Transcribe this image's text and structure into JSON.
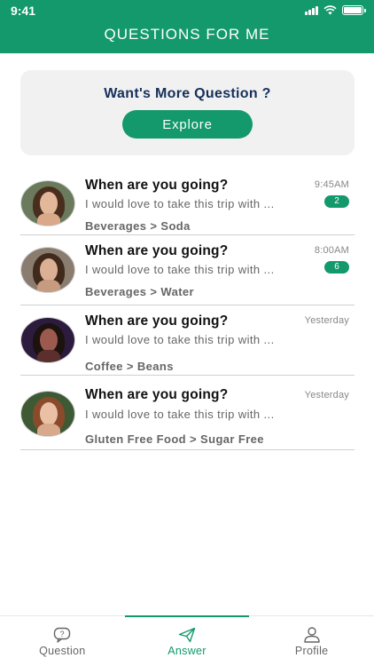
{
  "status_bar": {
    "time": "9:41"
  },
  "header": {
    "title": "QUESTIONS FOR ME"
  },
  "promo": {
    "title": "Want's More Question ?",
    "button_label": "Explore"
  },
  "questions": [
    {
      "title": "When are you going?",
      "preview": "I would love to take this trip with ...",
      "category": "Beverages > Soda",
      "time": "9:45AM",
      "badge": "2"
    },
    {
      "title": "When are you going?",
      "preview": "I would love to take this trip with ...",
      "category": "Beverages > Water",
      "time": "8:00AM",
      "badge": "6"
    },
    {
      "title": "When are you going?",
      "preview": "I would love to take this trip with ...",
      "category": "Coffee > Beans",
      "time": "Yesterday",
      "badge": null
    },
    {
      "title": "When are you going?",
      "preview": "I would love to take this trip with ...",
      "category": "Gluten Free Food > Sugar Free",
      "time": "Yesterday",
      "badge": null
    }
  ],
  "tabs": [
    {
      "label": "Question",
      "icon": "question-bubble-icon",
      "active": false
    },
    {
      "label": "Answer",
      "icon": "paper-plane-icon",
      "active": true
    },
    {
      "label": "Profile",
      "icon": "user-icon",
      "active": false
    }
  ],
  "colors": {
    "primary": "#13996b",
    "promo_title": "#15305a",
    "card_bg": "#f1f1f1"
  }
}
